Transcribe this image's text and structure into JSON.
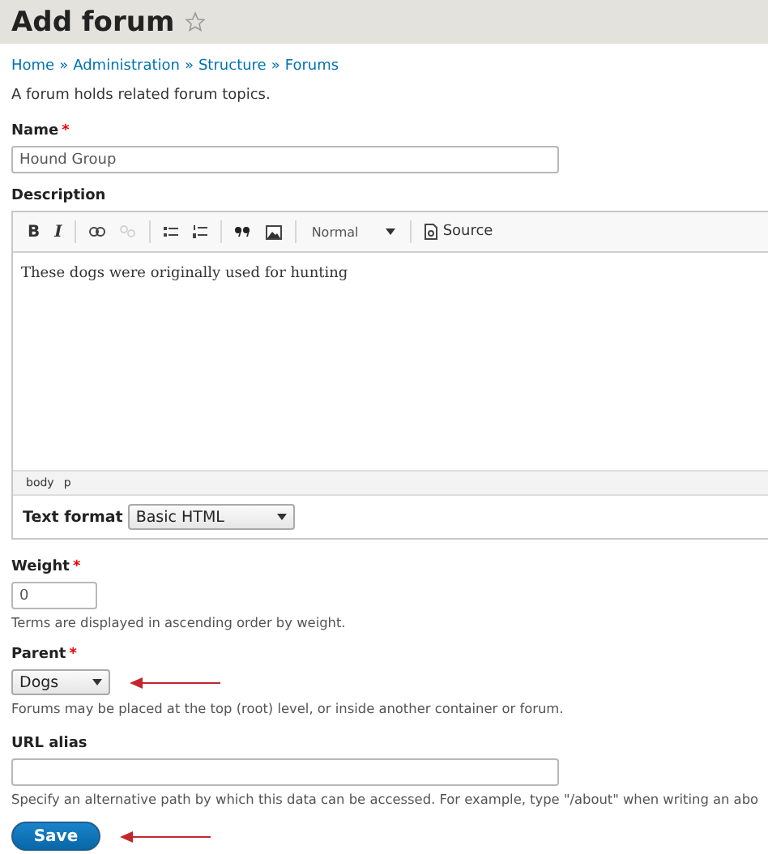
{
  "page": {
    "title": "Add forum"
  },
  "breadcrumb": [
    "Home",
    "Administration",
    "Structure",
    "Forums"
  ],
  "breadcrumb_separator": "»",
  "intro": "A forum holds related forum topics.",
  "name": {
    "label": "Name",
    "required_mark": "*",
    "value": "Hound Group"
  },
  "description": {
    "label": "Description",
    "toolbar": [
      {
        "kind": "bold",
        "label": "B",
        "disabled": false
      },
      {
        "kind": "italic",
        "label": "I",
        "disabled": false
      },
      {
        "kind": "separator"
      },
      {
        "kind": "link",
        "disabled": false
      },
      {
        "kind": "unlink",
        "disabled": true
      },
      {
        "kind": "separator"
      },
      {
        "kind": "bullets",
        "disabled": false
      },
      {
        "kind": "numbers",
        "disabled": false
      },
      {
        "kind": "separator"
      },
      {
        "kind": "quote",
        "disabled": false
      },
      {
        "kind": "image",
        "disabled": false
      },
      {
        "kind": "separator"
      },
      {
        "kind": "format",
        "label": "Normal"
      },
      {
        "kind": "separator"
      },
      {
        "kind": "source",
        "label": "Source",
        "disabled": false
      }
    ],
    "content": "These dogs were originally used for hunting",
    "path": [
      "body",
      "p"
    ],
    "format_label": "Text format",
    "format_value": "Basic HTML"
  },
  "weight": {
    "label": "Weight",
    "required_mark": "*",
    "value": "0",
    "help": "Terms are displayed in ascending order by weight."
  },
  "parent": {
    "label": "Parent",
    "required_mark": "*",
    "value": "Dogs",
    "help": "Forums may be placed at the top (root) level, or inside another container or forum.",
    "annotated": true
  },
  "url_alias": {
    "label": "URL alias",
    "help": "Specify an alternative path by which this data can be accessed. For example, type \"/about\" when writing an abo"
  },
  "save": {
    "label": "Save",
    "annotated": true
  }
}
